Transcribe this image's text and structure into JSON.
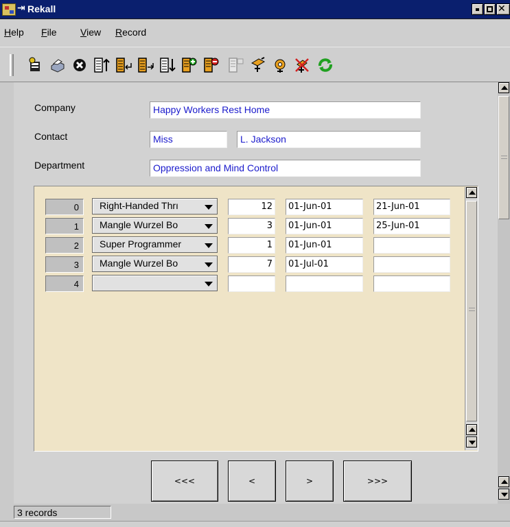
{
  "window": {
    "title": "Rekall"
  },
  "menu": [
    {
      "pre": "",
      "ul": "H",
      "post": "elp"
    },
    {
      "pre": "",
      "ul": "F",
      "post": "ile"
    },
    {
      "pre": "",
      "ul": "V",
      "post": "iew"
    },
    {
      "pre": "",
      "ul": "R",
      "post": "ecord"
    }
  ],
  "toolbar": [
    "printer-setup-icon",
    "print-icon",
    "cancel-icon",
    "first-record-icon",
    "previous-record-icon",
    "next-record-icon",
    "last-record-icon",
    "insert-record-icon",
    "delete-record-icon",
    "query-icon",
    "design-icon",
    "execute-icon",
    "clear-icon",
    "refresh-icon"
  ],
  "form": {
    "company_label": "Company",
    "company_value": "Happy Workers Rest Home",
    "contact_label": "Contact",
    "contact_title": "Miss",
    "contact_name": "L. Jackson",
    "department_label": "Department",
    "department_value": "Oppression and Mind Control"
  },
  "rows": [
    {
      "num": "0",
      "product": "Right-Handed Thrı",
      "qty": "12",
      "ordered": "01-Jun-01",
      "due": "21-Jun-01"
    },
    {
      "num": "1",
      "product": "Mangle Wurzel Bo",
      "qty": "3",
      "ordered": "01-Jun-01",
      "due": "25-Jun-01"
    },
    {
      "num": "2",
      "product": "Super Programmer",
      "qty": "1",
      "ordered": "01-Jun-01",
      "due": ""
    },
    {
      "num": "3",
      "product": "Mangle Wurzel Bo",
      "qty": "7",
      "ordered": "01-Jul-01",
      "due": ""
    },
    {
      "num": "4",
      "product": "",
      "qty": "",
      "ordered": "",
      "due": ""
    }
  ],
  "nav": {
    "first": "<<<",
    "prev": "<",
    "next": ">",
    "last": ">>>"
  },
  "status": "3 records"
}
